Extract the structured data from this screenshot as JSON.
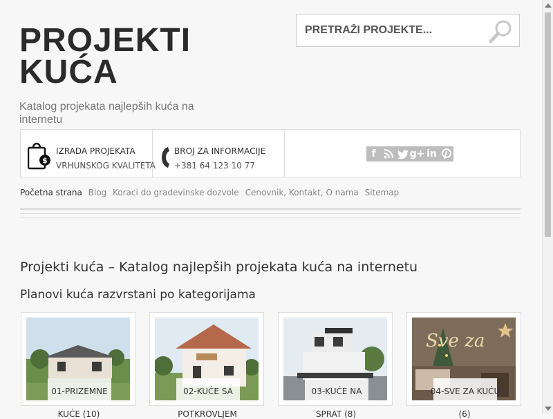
{
  "header": {
    "title_line1": "PROJEKTI",
    "title_line2": "KUĆA",
    "tagline": "Katalog projekata najlepših kuća na internetu"
  },
  "search": {
    "placeholder": "PRETRAŽI PROJEKTE...",
    "icon": "search-icon"
  },
  "info_bar": {
    "service_title": "IZRADA PROJEKATA",
    "service_sub": "VRHUNSKOG KVALITETA",
    "phone_title": "BROJ ZA INFORMACIJE",
    "phone_number": "+381 64 123 10 77",
    "social_icons": [
      "facebook-icon",
      "rss-icon",
      "twitter-icon",
      "google-plus-icon",
      "linkedin-icon",
      "pinterest-icon"
    ],
    "social_glyphs": [
      "f",
      "⧷",
      "ᴖ0",
      "g+",
      "in",
      "p"
    ]
  },
  "nav": {
    "items": [
      {
        "label": "Početna strana"
      },
      {
        "label": "Blog"
      },
      {
        "label": "Koraci do gradevinske dozvole"
      },
      {
        "label": "Cenovnik, Kontakt, O nama"
      },
      {
        "label": "Sitemap"
      }
    ]
  },
  "main": {
    "heading": "Projekti kuća – Katalog najlepših projekata kuća na internetu",
    "subheading": "Planovi kuća razvrstani po kategorijama",
    "categories": [
      {
        "label": "01-PRIZEMNE",
        "caption": "KUĆE (10)"
      },
      {
        "label": "02-KUĆE SA",
        "caption": "POTKROVLJEM"
      },
      {
        "label": "03-KUĆE NA",
        "caption": "SPRAT (8)"
      },
      {
        "label": "04-SVE ZA KUĆU",
        "caption": "(6)"
      }
    ]
  },
  "colors": {
    "background": "#f7f7f7",
    "title": "#2b2b2b",
    "border": "#dddddd",
    "social": "#bdbdbd"
  }
}
